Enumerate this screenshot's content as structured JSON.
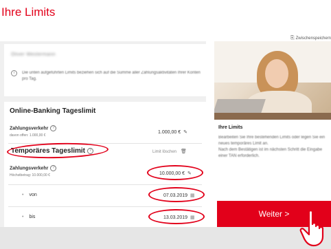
{
  "page": {
    "title": "Ihre Limits",
    "save_link": "Zwischenspeichern"
  },
  "account": {
    "name": "Oliver Westermann",
    "info_text": "Die unten aufgeführten Limits beziehen sich auf die Summe aller Zahlungsaktivitäten Ihrer Konten pro Tag."
  },
  "online_banking": {
    "title": "Online-Banking Tageslimit",
    "payment_label": "Zahlungsverkehr",
    "payment_sub": "davon offen: 1.000,00 €",
    "payment_value": "1.000,00 €"
  },
  "temporary": {
    "title": "Temporäres Tageslimit",
    "delete_label": "Limit löschen",
    "payment_label": "Zahlungsverkehr",
    "payment_sub": "Höchstbetrag: 10.000,00 €",
    "payment_value": "10.000,00 €",
    "from_label": "von",
    "from_value": "07.03.2019",
    "to_label": "bis",
    "to_value": "13.03.2019"
  },
  "help": {
    "title": "Ihre Limits",
    "text_1": "Bearbeiten Sie Ihre bestehenden Limits oder legen Sie ein neues temporäres Limit an.",
    "text_2": "Nach dem Bestätigen ist im nächsten Schritt die Eingabe einer TAN erforderlich."
  },
  "actions": {
    "next_label": "Weiter >"
  },
  "icons": {
    "info": "info-icon",
    "help": "help-icon",
    "pencil": "pencil-icon",
    "trash": "trash-icon",
    "calendar": "calendar-icon",
    "save": "save-icon",
    "cursor": "hand-cursor-icon"
  },
  "colors": {
    "brand_red": "#e2001a",
    "panel_gray": "#f0f0f0"
  }
}
